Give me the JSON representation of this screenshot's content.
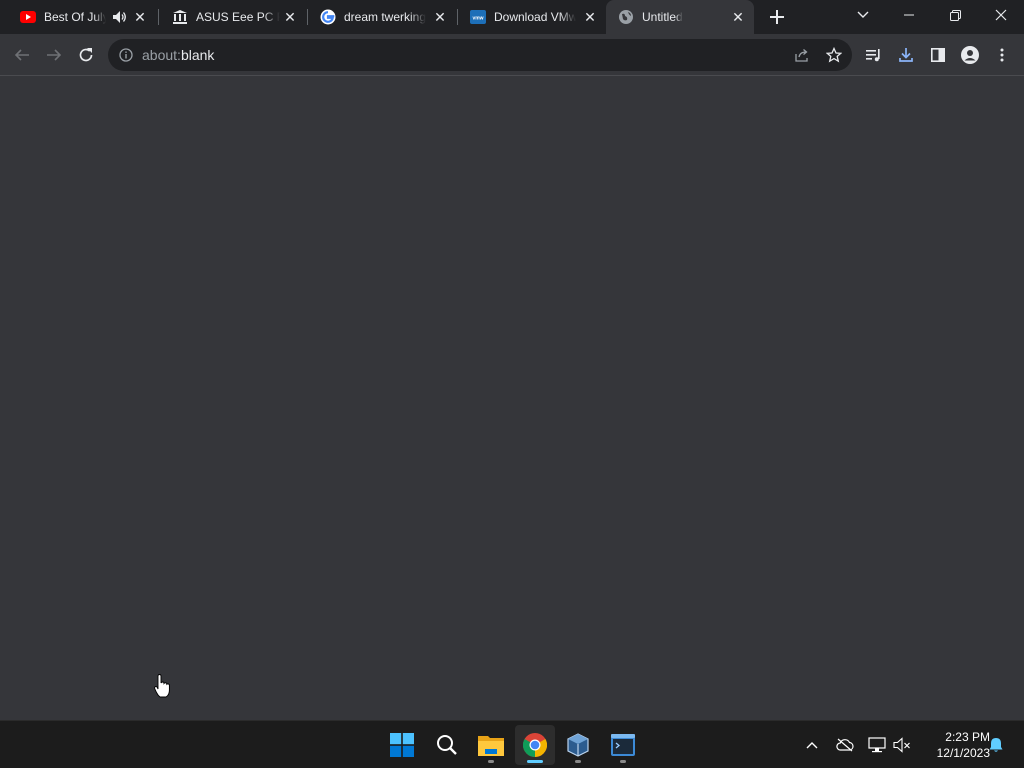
{
  "tabs": [
    {
      "title": "Best Of July",
      "favicon": "youtube-icon",
      "audio": true
    },
    {
      "title": "ASUS Eee PC R",
      "favicon": "museum-icon"
    },
    {
      "title": "dream twerking",
      "favicon": "google-icon"
    },
    {
      "title": "Download VMw",
      "favicon": "vmware-icon"
    },
    {
      "title": "Untitled",
      "favicon": "globe-icon",
      "active": true
    }
  ],
  "omnibox": {
    "url_scheme": "about:",
    "url_path": "blank"
  },
  "taskbar": {
    "apps": [
      "start-icon",
      "search-icon",
      "file-explorer-icon",
      "chrome-icon",
      "virtualbox-icon",
      "terminal-icon"
    ],
    "clock": {
      "time": "2:23 PM",
      "date": "12/1/2023"
    }
  },
  "colors": {
    "tabstrip_bg": "#202124",
    "toolbar_bg": "#35363a",
    "omnibox_bg": "#202124",
    "taskbar_bg": "#1c1c1c",
    "accent": "#60cdff"
  }
}
